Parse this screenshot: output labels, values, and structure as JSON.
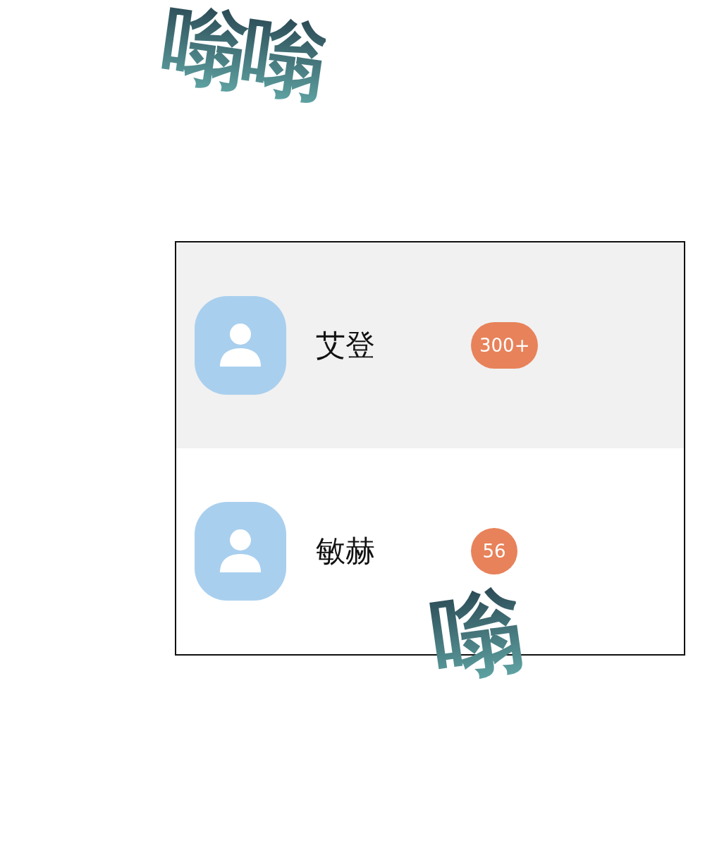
{
  "sfx_top": "嗡嗡",
  "contacts": [
    {
      "name": "艾登",
      "badge": "300+",
      "selected": true
    },
    {
      "name": "敏赫",
      "badge": "56",
      "selected": false
    }
  ],
  "sfx_bottom": "嗡"
}
